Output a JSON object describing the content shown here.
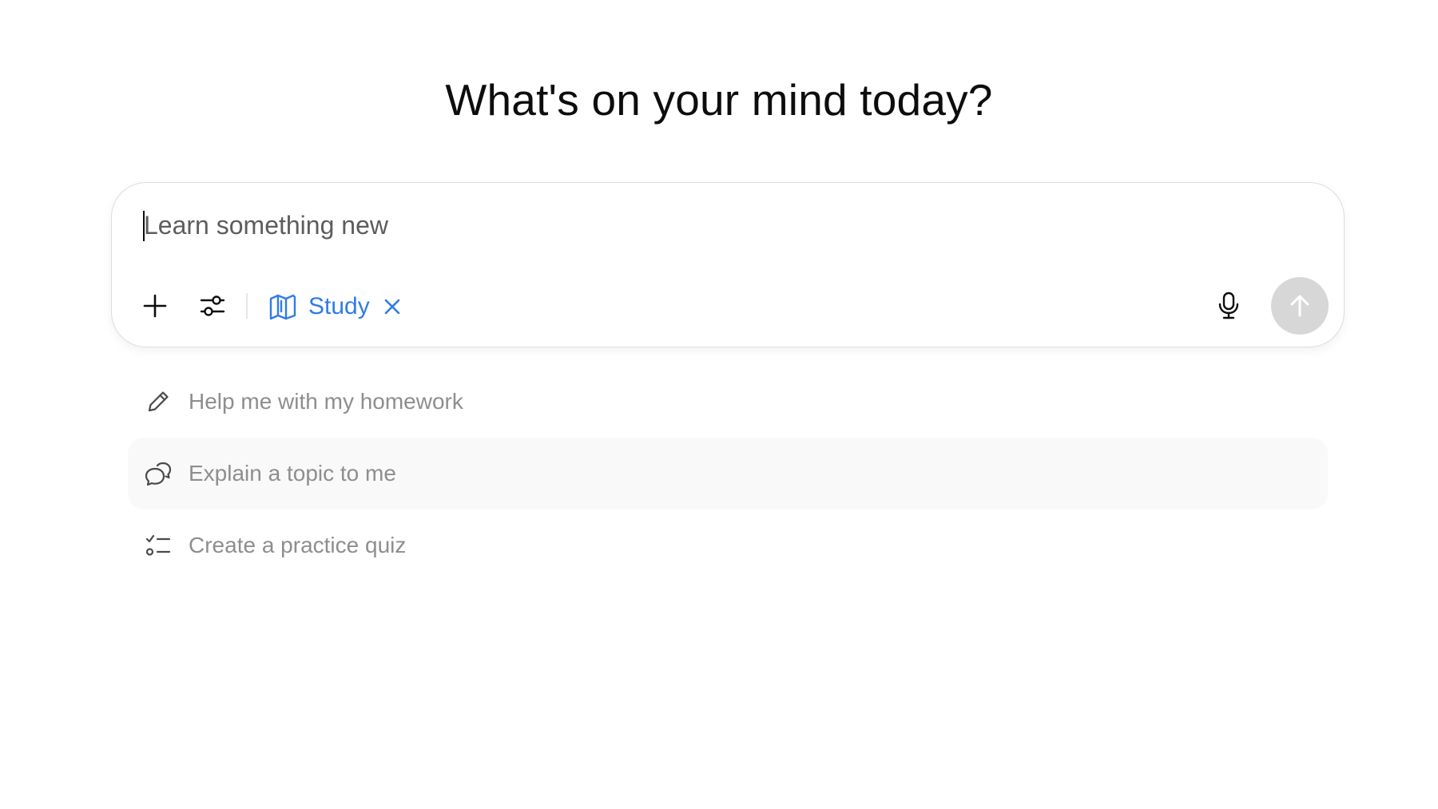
{
  "header": {
    "title": "What's on your mind today?"
  },
  "composer": {
    "placeholder": "Learn something new",
    "value": "",
    "mode_label": "Study",
    "icons": {
      "add": "plus-icon",
      "tools": "sliders-icon",
      "mode": "open-book-icon",
      "remove_mode": "close-icon",
      "voice": "microphone-icon",
      "send": "arrow-up-icon"
    }
  },
  "suggestions": [
    {
      "label": "Help me with my homework",
      "icon": "pencil-icon"
    },
    {
      "label": "Explain a topic to me",
      "icon": "chat-bubbles-icon"
    },
    {
      "label": "Create a practice quiz",
      "icon": "checklist-icon"
    }
  ],
  "colors": {
    "accent": "#2f7ce6",
    "send_disabled": "#d7d7d7",
    "muted_text": "#8e8e8e",
    "hover_row": "#f9f9f9"
  }
}
